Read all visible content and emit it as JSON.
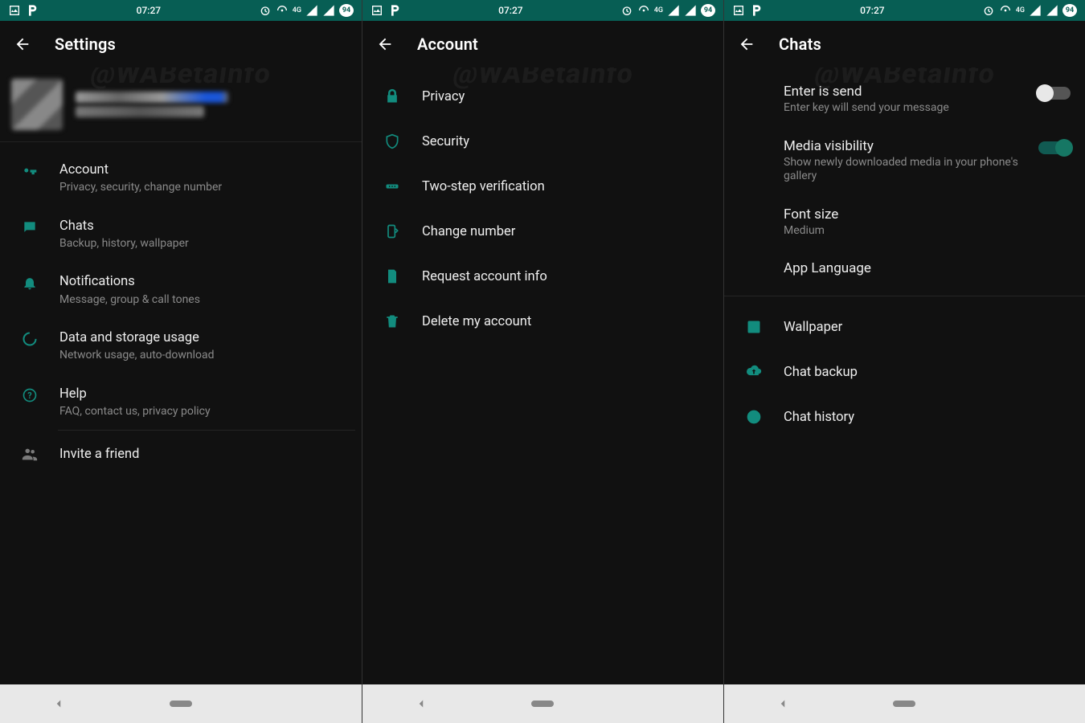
{
  "watermark": "@WABetaInfo",
  "status": {
    "time": "07:27",
    "badge": "94"
  },
  "screens": [
    {
      "title": "Settings",
      "items": [
        {
          "title": "Account",
          "sub": "Privacy, security, change number"
        },
        {
          "title": "Chats",
          "sub": "Backup, history, wallpaper"
        },
        {
          "title": "Notifications",
          "sub": "Message, group & call tones"
        },
        {
          "title": "Data and storage usage",
          "sub": "Network usage, auto-download"
        },
        {
          "title": "Help",
          "sub": "FAQ, contact us, privacy policy"
        }
      ],
      "invite": "Invite a friend"
    },
    {
      "title": "Account",
      "items": [
        {
          "title": "Privacy"
        },
        {
          "title": "Security"
        },
        {
          "title": "Two-step verification"
        },
        {
          "title": "Change number"
        },
        {
          "title": "Request account info"
        },
        {
          "title": "Delete my account"
        }
      ]
    },
    {
      "title": "Chats",
      "settings": {
        "enter_send": {
          "title": "Enter is send",
          "sub": "Enter key will send your message",
          "on": false
        },
        "media_vis": {
          "title": "Media visibility",
          "sub": "Show newly downloaded media in your phone's gallery",
          "on": true
        },
        "font_size": {
          "title": "Font size",
          "sub": "Medium"
        },
        "app_lang": {
          "title": "App Language"
        }
      },
      "items2": [
        {
          "title": "Wallpaper"
        },
        {
          "title": "Chat backup"
        },
        {
          "title": "Chat history"
        }
      ]
    }
  ]
}
